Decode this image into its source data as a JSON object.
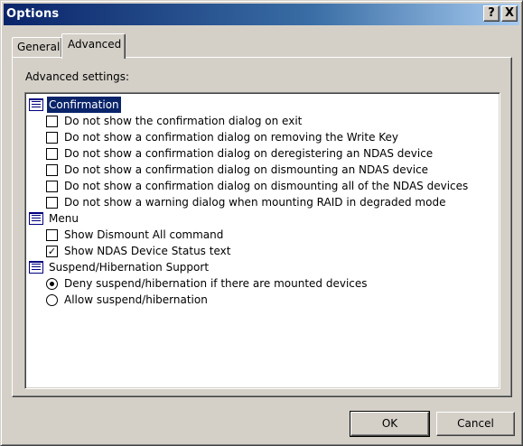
{
  "window": {
    "title": "Options",
    "help_button": "?",
    "close_button": "X"
  },
  "tabs": [
    {
      "label": "General",
      "active": false
    },
    {
      "label": "Advanced",
      "active": true
    }
  ],
  "panel": {
    "section_label": "Advanced settings:",
    "groups": [
      {
        "label": "Confirmation",
        "selected": true,
        "items": [
          {
            "type": "checkbox",
            "label": "Do not show the confirmation dialog on exit",
            "checked": false
          },
          {
            "type": "checkbox",
            "label": "Do not show a confirmation dialog on removing the Write Key",
            "checked": false
          },
          {
            "type": "checkbox",
            "label": "Do not show a confirmation dialog on deregistering an NDAS device",
            "checked": false
          },
          {
            "type": "checkbox",
            "label": "Do not show a confirmation dialog on dismounting an NDAS device",
            "checked": false
          },
          {
            "type": "checkbox",
            "label": "Do not show a confirmation dialog on dismounting all of the NDAS devices",
            "checked": false
          },
          {
            "type": "checkbox",
            "label": "Do not show a warning dialog when mounting RAID in degraded mode",
            "checked": false
          }
        ]
      },
      {
        "label": "Menu",
        "selected": false,
        "items": [
          {
            "type": "checkbox",
            "label": "Show Dismount All command",
            "checked": false
          },
          {
            "type": "checkbox",
            "label": "Show NDAS Device Status text",
            "checked": true
          }
        ]
      },
      {
        "label": "Suspend/Hibernation Support",
        "selected": false,
        "items": [
          {
            "type": "radio",
            "label": "Deny suspend/hibernation if there are mounted devices",
            "checked": true
          },
          {
            "type": "radio",
            "label": "Allow suspend/hibernation",
            "checked": false
          }
        ]
      }
    ]
  },
  "buttons": {
    "ok": "OK",
    "cancel": "Cancel"
  },
  "colors": {
    "titlebar_start": "#0a246a",
    "titlebar_end": "#a6caf0",
    "selection": "#0a246a",
    "face": "#d4d0c8"
  },
  "icons": {
    "group": "settings-group-icon",
    "checkbox": "checkbox-icon",
    "radio": "radio-icon"
  }
}
